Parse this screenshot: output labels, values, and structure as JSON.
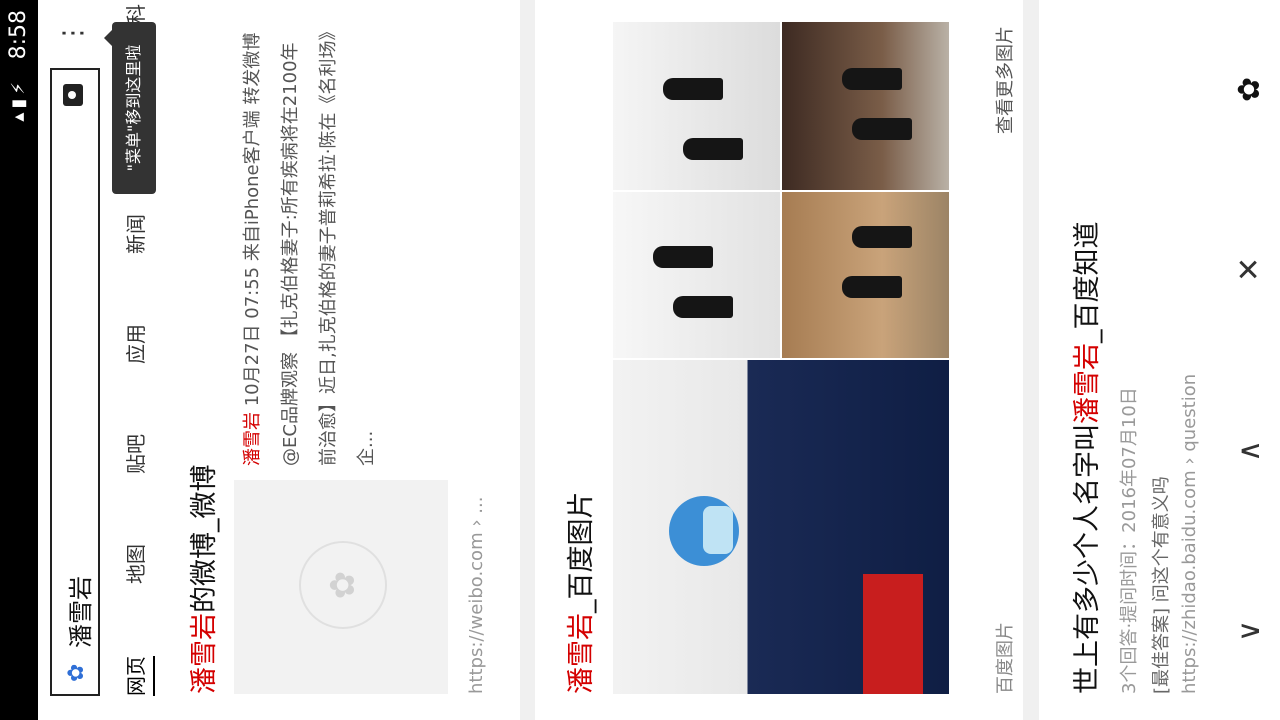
{
  "status": {
    "time": "8:58"
  },
  "search": {
    "query": "潘雪岩"
  },
  "tabs": [
    "网页",
    "地图",
    "贴吧",
    "应用",
    "新闻",
    "百科"
  ],
  "tooltip": "\"菜单\"移到这里啦",
  "result1": {
    "title_hl": "潘雪岩",
    "title_rest": "的微博_微博",
    "author": "潘雪岩",
    "snippet": "10月27日 07:55 来自iPhone客户端 转发微博 @EC品牌观察 【扎克伯格妻子:所有疾病将在2100年前治愈】近日,扎克伯格的妻子普莉希拉·陈在《名利场》企...",
    "url": "https://weibo.com › ..."
  },
  "result2": {
    "title_hl": "潘雪岩",
    "title_rest": "_百度图片",
    "source": "百度图片",
    "more": "查看更多图片"
  },
  "result3": {
    "title_pre": "世上有多少个人名字叫",
    "title_hl": "潘雪岩",
    "title_post": "_百度知道",
    "meta1": "3个回答·提问时间：2016年07月10日",
    "meta2": "[最佳答案] 问这个有意义吗",
    "url": "https://zhidao.baidu.com › question"
  },
  "nav": {
    "back": "∨",
    "forward": "∧",
    "close": "✕",
    "home": "✿"
  },
  "colors": {
    "highlight": "#d40000",
    "accent": "#2f6fd6"
  },
  "icons": [
    "wifi-icon",
    "signal-icon",
    "battery-icon",
    "baidu-paw-icon",
    "camera-icon",
    "more-icon"
  ]
}
